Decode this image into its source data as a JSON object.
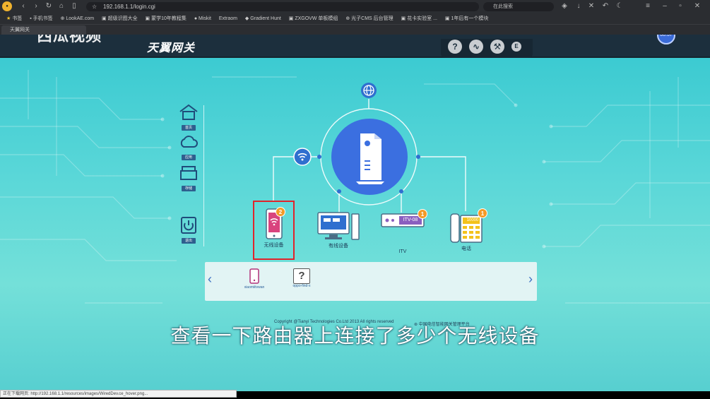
{
  "browser": {
    "address": "192.168.1.1/login.cgi",
    "search_placeholder": "在此搜索",
    "tab_title": "天翼网关",
    "bookmarks": [
      "书签",
      "手机书签",
      "LookAE.com",
      "超级识图大全",
      "蒙学10年教程集",
      "Miskit",
      "Extraom",
      "Gradient Hunt",
      "ZXGOVW 单板模组",
      "光子CMS 后台管理",
      "花卡实验室 ...",
      "1年后有一个模块"
    ],
    "status_text": "正在下载网页: http://192.168.1.1/resources/images/WiredDev.ce_hover.png..."
  },
  "overlay": {
    "watermark": "西瓜视频",
    "timer": "00:37",
    "subtitle": "查看一下路由器上连接了多少个无线设备"
  },
  "gateway": {
    "brand": "天翼网关",
    "nav": [
      {
        "label": "首页"
      },
      {
        "label": "应用"
      },
      {
        "label": "存储"
      },
      {
        "label": "退出"
      }
    ],
    "devices": [
      {
        "label": "无线设备",
        "count": "2"
      },
      {
        "label": "有线设备",
        "count": ""
      },
      {
        "label": "ITV",
        "count": "1",
        "screen": "ITV-08"
      },
      {
        "label": "电话",
        "count": "1",
        "screen": "10000"
      }
    ],
    "panel_devices": [
      {
        "name": "xiaomiitvwan"
      },
      {
        "name": "oppo-find-x"
      }
    ],
    "footer": "Copyright @Tianyi Technologies Co.Ltd 2013   All rights reserved",
    "footer_right": "中国电信智能网关管理平台"
  },
  "colors": {
    "accent": "#3a6bd8",
    "badge": "#f39a27",
    "selection": "#e0242b",
    "topbar": "#1c2f3d"
  }
}
